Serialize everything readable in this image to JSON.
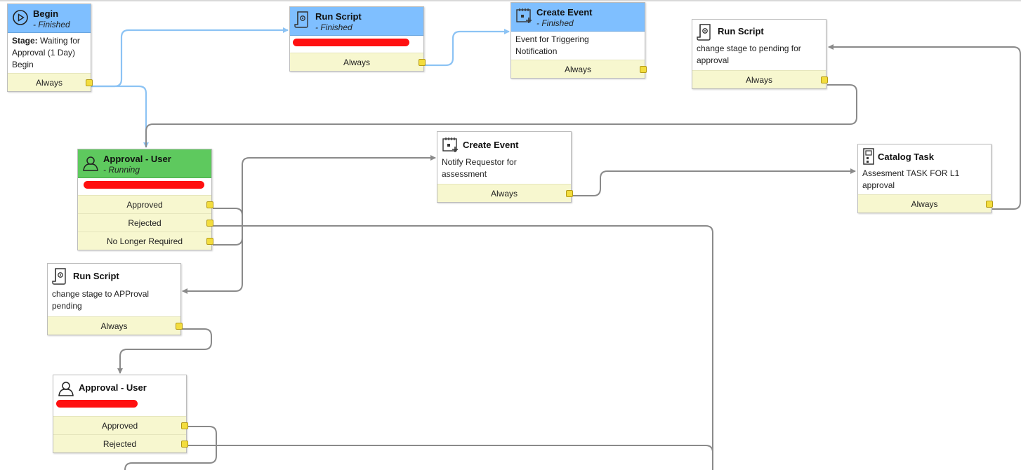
{
  "workflow": {
    "colors": {
      "finished": "#7fbfff",
      "running": "#5ec95e",
      "condition": "#f7f7cf",
      "port": "#f3dd3e",
      "wire": "#8a8a8a",
      "active_wire": "#8cc3f4"
    },
    "nodes": {
      "begin": {
        "title": "Begin",
        "state": "- Finished",
        "stage_label": "Stage:",
        "stage_text": " Waiting for Approval (1 Day)",
        "line2": "Begin",
        "conditions": [
          "Always"
        ],
        "icon": "play-circle-icon"
      },
      "run_script_1": {
        "title": "Run Script",
        "state": "- Finished",
        "conditions": [
          "Always"
        ],
        "icon": "script-icon"
      },
      "create_event_1": {
        "title": "Create Event",
        "state": "- Finished",
        "description": "Event for Triggering Notification",
        "conditions": [
          "Always"
        ],
        "icon": "calendar-event-icon"
      },
      "run_script_2": {
        "title": "Run Script",
        "description": "change stage to pending for approval",
        "conditions": [
          "Always"
        ],
        "icon": "script-icon"
      },
      "approval_user_1": {
        "title": "Approval - User",
        "state": "- Running",
        "conditions": [
          "Approved",
          "Rejected",
          "No Longer Required"
        ],
        "icon": "user-icon"
      },
      "create_event_2": {
        "title": "Create Event",
        "description": "Notify Requestor for assessment",
        "conditions": [
          "Always"
        ],
        "icon": "calendar-event-icon"
      },
      "catalog_task": {
        "title": "Catalog Task",
        "description": "Assesment TASK FOR L1 approval",
        "conditions": [
          "Always"
        ],
        "icon": "catalog-task-icon"
      },
      "run_script_3": {
        "title": "Run Script",
        "description": "change stage to APProval pending",
        "conditions": [
          "Always"
        ],
        "icon": "script-icon"
      },
      "approval_user_2": {
        "title": "Approval - User",
        "conditions": [
          "Approved",
          "Rejected"
        ],
        "icon": "user-icon"
      }
    }
  }
}
